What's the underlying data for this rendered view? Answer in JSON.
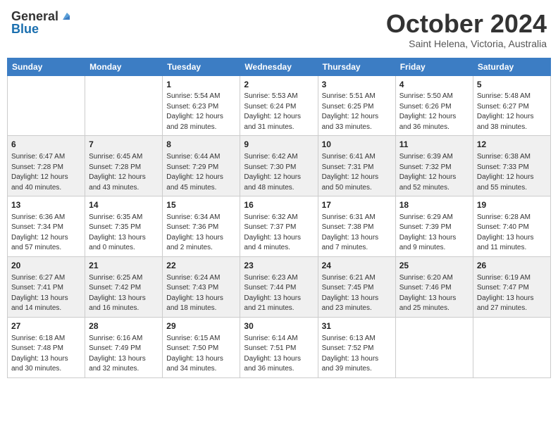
{
  "header": {
    "logo_general": "General",
    "logo_blue": "Blue",
    "month": "October 2024",
    "location": "Saint Helena, Victoria, Australia"
  },
  "days_of_week": [
    "Sunday",
    "Monday",
    "Tuesday",
    "Wednesday",
    "Thursday",
    "Friday",
    "Saturday"
  ],
  "weeks": [
    {
      "shaded": false,
      "days": [
        {
          "date": "",
          "info": ""
        },
        {
          "date": "",
          "info": ""
        },
        {
          "date": "1",
          "info": "Sunrise: 5:54 AM\nSunset: 6:23 PM\nDaylight: 12 hours\nand 28 minutes."
        },
        {
          "date": "2",
          "info": "Sunrise: 5:53 AM\nSunset: 6:24 PM\nDaylight: 12 hours\nand 31 minutes."
        },
        {
          "date": "3",
          "info": "Sunrise: 5:51 AM\nSunset: 6:25 PM\nDaylight: 12 hours\nand 33 minutes."
        },
        {
          "date": "4",
          "info": "Sunrise: 5:50 AM\nSunset: 6:26 PM\nDaylight: 12 hours\nand 36 minutes."
        },
        {
          "date": "5",
          "info": "Sunrise: 5:48 AM\nSunset: 6:27 PM\nDaylight: 12 hours\nand 38 minutes."
        }
      ]
    },
    {
      "shaded": true,
      "days": [
        {
          "date": "6",
          "info": "Sunrise: 6:47 AM\nSunset: 7:28 PM\nDaylight: 12 hours\nand 40 minutes."
        },
        {
          "date": "7",
          "info": "Sunrise: 6:45 AM\nSunset: 7:28 PM\nDaylight: 12 hours\nand 43 minutes."
        },
        {
          "date": "8",
          "info": "Sunrise: 6:44 AM\nSunset: 7:29 PM\nDaylight: 12 hours\nand 45 minutes."
        },
        {
          "date": "9",
          "info": "Sunrise: 6:42 AM\nSunset: 7:30 PM\nDaylight: 12 hours\nand 48 minutes."
        },
        {
          "date": "10",
          "info": "Sunrise: 6:41 AM\nSunset: 7:31 PM\nDaylight: 12 hours\nand 50 minutes."
        },
        {
          "date": "11",
          "info": "Sunrise: 6:39 AM\nSunset: 7:32 PM\nDaylight: 12 hours\nand 52 minutes."
        },
        {
          "date": "12",
          "info": "Sunrise: 6:38 AM\nSunset: 7:33 PM\nDaylight: 12 hours\nand 55 minutes."
        }
      ]
    },
    {
      "shaded": false,
      "days": [
        {
          "date": "13",
          "info": "Sunrise: 6:36 AM\nSunset: 7:34 PM\nDaylight: 12 hours\nand 57 minutes."
        },
        {
          "date": "14",
          "info": "Sunrise: 6:35 AM\nSunset: 7:35 PM\nDaylight: 13 hours\nand 0 minutes."
        },
        {
          "date": "15",
          "info": "Sunrise: 6:34 AM\nSunset: 7:36 PM\nDaylight: 13 hours\nand 2 minutes."
        },
        {
          "date": "16",
          "info": "Sunrise: 6:32 AM\nSunset: 7:37 PM\nDaylight: 13 hours\nand 4 minutes."
        },
        {
          "date": "17",
          "info": "Sunrise: 6:31 AM\nSunset: 7:38 PM\nDaylight: 13 hours\nand 7 minutes."
        },
        {
          "date": "18",
          "info": "Sunrise: 6:29 AM\nSunset: 7:39 PM\nDaylight: 13 hours\nand 9 minutes."
        },
        {
          "date": "19",
          "info": "Sunrise: 6:28 AM\nSunset: 7:40 PM\nDaylight: 13 hours\nand 11 minutes."
        }
      ]
    },
    {
      "shaded": true,
      "days": [
        {
          "date": "20",
          "info": "Sunrise: 6:27 AM\nSunset: 7:41 PM\nDaylight: 13 hours\nand 14 minutes."
        },
        {
          "date": "21",
          "info": "Sunrise: 6:25 AM\nSunset: 7:42 PM\nDaylight: 13 hours\nand 16 minutes."
        },
        {
          "date": "22",
          "info": "Sunrise: 6:24 AM\nSunset: 7:43 PM\nDaylight: 13 hours\nand 18 minutes."
        },
        {
          "date": "23",
          "info": "Sunrise: 6:23 AM\nSunset: 7:44 PM\nDaylight: 13 hours\nand 21 minutes."
        },
        {
          "date": "24",
          "info": "Sunrise: 6:21 AM\nSunset: 7:45 PM\nDaylight: 13 hours\nand 23 minutes."
        },
        {
          "date": "25",
          "info": "Sunrise: 6:20 AM\nSunset: 7:46 PM\nDaylight: 13 hours\nand 25 minutes."
        },
        {
          "date": "26",
          "info": "Sunrise: 6:19 AM\nSunset: 7:47 PM\nDaylight: 13 hours\nand 27 minutes."
        }
      ]
    },
    {
      "shaded": false,
      "days": [
        {
          "date": "27",
          "info": "Sunrise: 6:18 AM\nSunset: 7:48 PM\nDaylight: 13 hours\nand 30 minutes."
        },
        {
          "date": "28",
          "info": "Sunrise: 6:16 AM\nSunset: 7:49 PM\nDaylight: 13 hours\nand 32 minutes."
        },
        {
          "date": "29",
          "info": "Sunrise: 6:15 AM\nSunset: 7:50 PM\nDaylight: 13 hours\nand 34 minutes."
        },
        {
          "date": "30",
          "info": "Sunrise: 6:14 AM\nSunset: 7:51 PM\nDaylight: 13 hours\nand 36 minutes."
        },
        {
          "date": "31",
          "info": "Sunrise: 6:13 AM\nSunset: 7:52 PM\nDaylight: 13 hours\nand 39 minutes."
        },
        {
          "date": "",
          "info": ""
        },
        {
          "date": "",
          "info": ""
        }
      ]
    }
  ]
}
